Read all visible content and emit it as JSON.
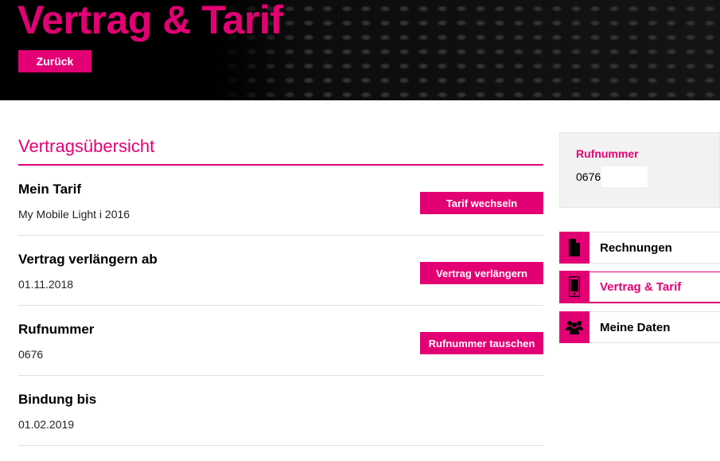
{
  "header": {
    "title": "Vertrag & Tarif",
    "back_label": "Zurück"
  },
  "main": {
    "section_title": "Vertragsübersicht",
    "rows": [
      {
        "label": "Mein Tarif",
        "value": "My Mobile Light i 2016",
        "button": "Tarif wechseln"
      },
      {
        "label": "Vertrag verlängern ab",
        "value": "01.11.2018",
        "button": "Vertrag verlängern"
      },
      {
        "label": "Rufnummer",
        "value": "0676",
        "button": "Rufnummer tauschen"
      },
      {
        "label": "Bindung bis",
        "value": "01.02.2019"
      }
    ]
  },
  "sidebar": {
    "phone_label": "Rufnummer",
    "phone_value": "0676",
    "nav": [
      {
        "label": "Rechnungen",
        "icon": "document-icon",
        "active": false
      },
      {
        "label": "Vertrag & Tarif",
        "icon": "mobile-phone-icon",
        "active": true
      },
      {
        "label": "Meine Daten",
        "icon": "people-icon",
        "active": false
      }
    ]
  },
  "colors": {
    "accent": "#e20074",
    "header_bg": "#000000",
    "divider": "#e0e0e0"
  }
}
